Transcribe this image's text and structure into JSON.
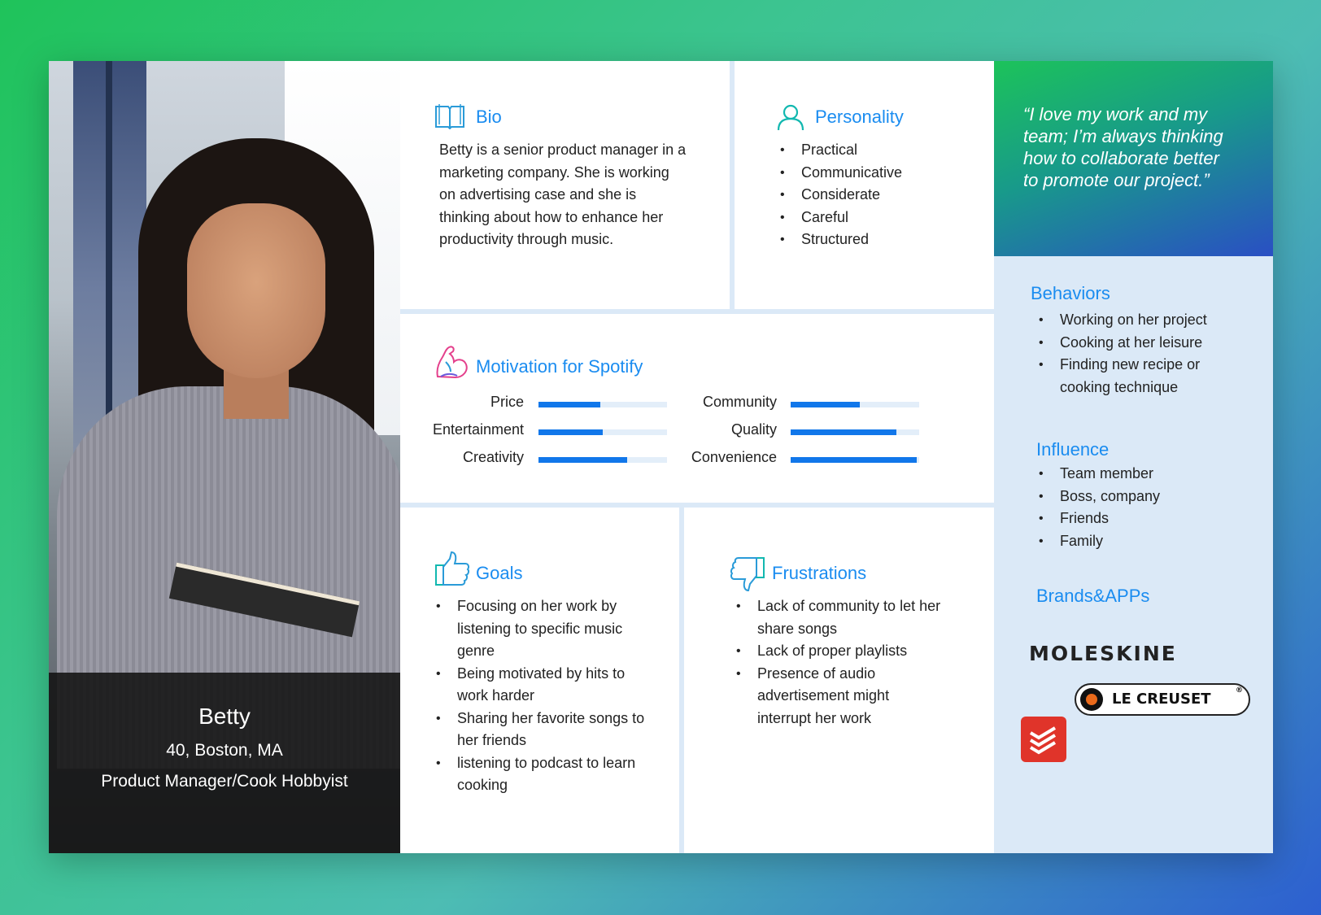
{
  "persona": {
    "name": "Betty",
    "age_location": "40, Boston, MA",
    "role": "Product Manager/Cook Hobbyist"
  },
  "bio": {
    "title": "Bio",
    "lines": [
      "Betty is a senior product manager in a",
      "marketing company. She is working",
      "on advertising case and she is",
      "thinking about how to enhance her",
      "productivity through music."
    ]
  },
  "personality": {
    "title": "Personality",
    "items": [
      "Practical",
      "Communicative",
      "Considerate",
      "Careful",
      "Structured"
    ]
  },
  "motivation": {
    "title": "Motivation for Spotify",
    "items": [
      {
        "label": "Price",
        "value": 0.48
      },
      {
        "label": "Entertainment",
        "value": 0.5
      },
      {
        "label": "Creativity",
        "value": 0.69
      },
      {
        "label": "Community",
        "value": 0.54
      },
      {
        "label": "Quality",
        "value": 0.82
      },
      {
        "label": "Convenience",
        "value": 0.98
      }
    ]
  },
  "goals": {
    "title": "Goals",
    "items": [
      [
        "Focusing on her work by",
        "listening to specific music",
        "genre"
      ],
      [
        "Being motivated by hits to",
        "work harder"
      ],
      [
        "Sharing her favorite songs to",
        "her friends"
      ],
      [
        "listening to podcast to learn",
        "cooking"
      ]
    ]
  },
  "frustrations": {
    "title": "Frustrations",
    "items": [
      [
        "Lack of community to let her",
        "share songs"
      ],
      [
        "Lack of proper playlists"
      ],
      [
        "Presence of audio",
        "advertisement might",
        "interrupt her work"
      ]
    ]
  },
  "quote": {
    "lines": [
      "“I love my work and my",
      "team; I’m always thinking",
      "how to collaborate better",
      "to promote our project.”"
    ]
  },
  "behaviors": {
    "title": "Behaviors",
    "items": [
      [
        "Working on her project"
      ],
      [
        "Cooking at her leisure"
      ],
      [
        "Finding new recipe or",
        "cooking technique"
      ]
    ]
  },
  "influence": {
    "title": "Influence",
    "items": [
      "Team member",
      "Boss, company",
      "Friends",
      "Family"
    ]
  },
  "brands": {
    "title": "Brands&APPs",
    "moleskine": "MOLESKINE",
    "lecreuset": "LE CREUSET",
    "lecreuset_mark": "®",
    "todoist_icon": "todoist-logo-icon"
  },
  "colors": {
    "accent": "#1a8cf0",
    "bar_fill": "#1177ea",
    "bar_track": "#e3eef9",
    "sidebar_bg": "#dbe9f7"
  }
}
